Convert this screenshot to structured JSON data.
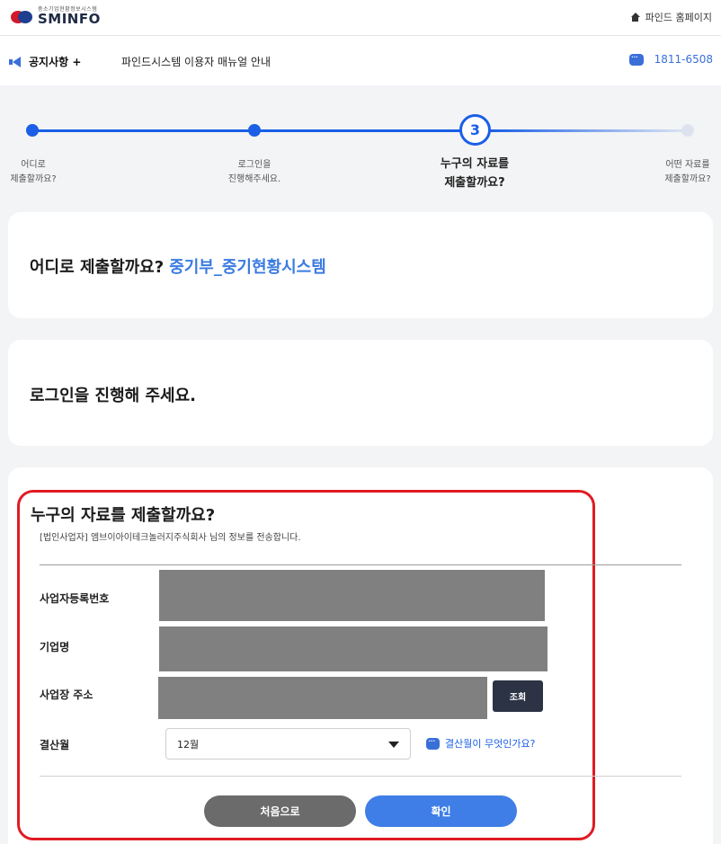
{
  "header": {
    "logo_sub": "중소기업현황정보시스템",
    "logo_name": "SMINFO",
    "home_link": "파인드 홈페이지"
  },
  "notice": {
    "label": "공지사항 +",
    "text": "파인드시스템 이용자 매뉴얼 안내",
    "phone": "1811-6508"
  },
  "stepper": {
    "current_number": "3",
    "steps": [
      {
        "label": "어디로\n제출할까요?"
      },
      {
        "label": "로그인을\n진행해주세요."
      },
      {
        "label": "누구의 자료를\n제출할까요?"
      },
      {
        "label": "어떤 자료를\n제출할까요?"
      }
    ]
  },
  "section1": {
    "title": "어디로 제출할까요?",
    "value": "중기부_중기현황시스템"
  },
  "section2": {
    "title": "로그인을 진행해 주세요."
  },
  "section3": {
    "title": "누구의 자료를 제출할까요?",
    "subtitle": "[법인사업자] 엠브이아이테크놀러지주식회사 님의 정보를 전송합니다.",
    "fields": {
      "biz_no_label": "사업자등록번호",
      "company_label": "기업명",
      "address_label": "사업장 주소",
      "fiscal_label": "결산월"
    },
    "search_button": "조회",
    "fiscal_month": "12월",
    "help_link": "결산월이 무엇인가요?",
    "reset_button": "처음으로",
    "confirm_button": "확인"
  },
  "colors": {
    "accent": "#1a5fe6",
    "highlight": "#e01b23",
    "mask": "#808080"
  }
}
